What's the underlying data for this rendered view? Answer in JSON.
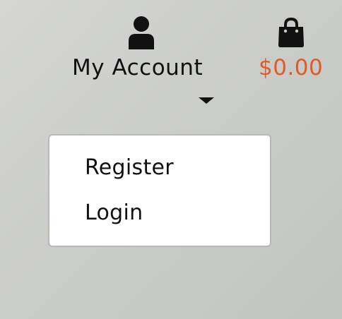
{
  "header": {
    "account": {
      "label": "My Account",
      "icon": "user-icon"
    },
    "cart": {
      "total": "$0.00",
      "icon": "shopping-bag-icon",
      "total_color": "#e05a2b"
    }
  },
  "account_menu": {
    "items": [
      {
        "label": "Register"
      },
      {
        "label": "Login"
      }
    ]
  }
}
